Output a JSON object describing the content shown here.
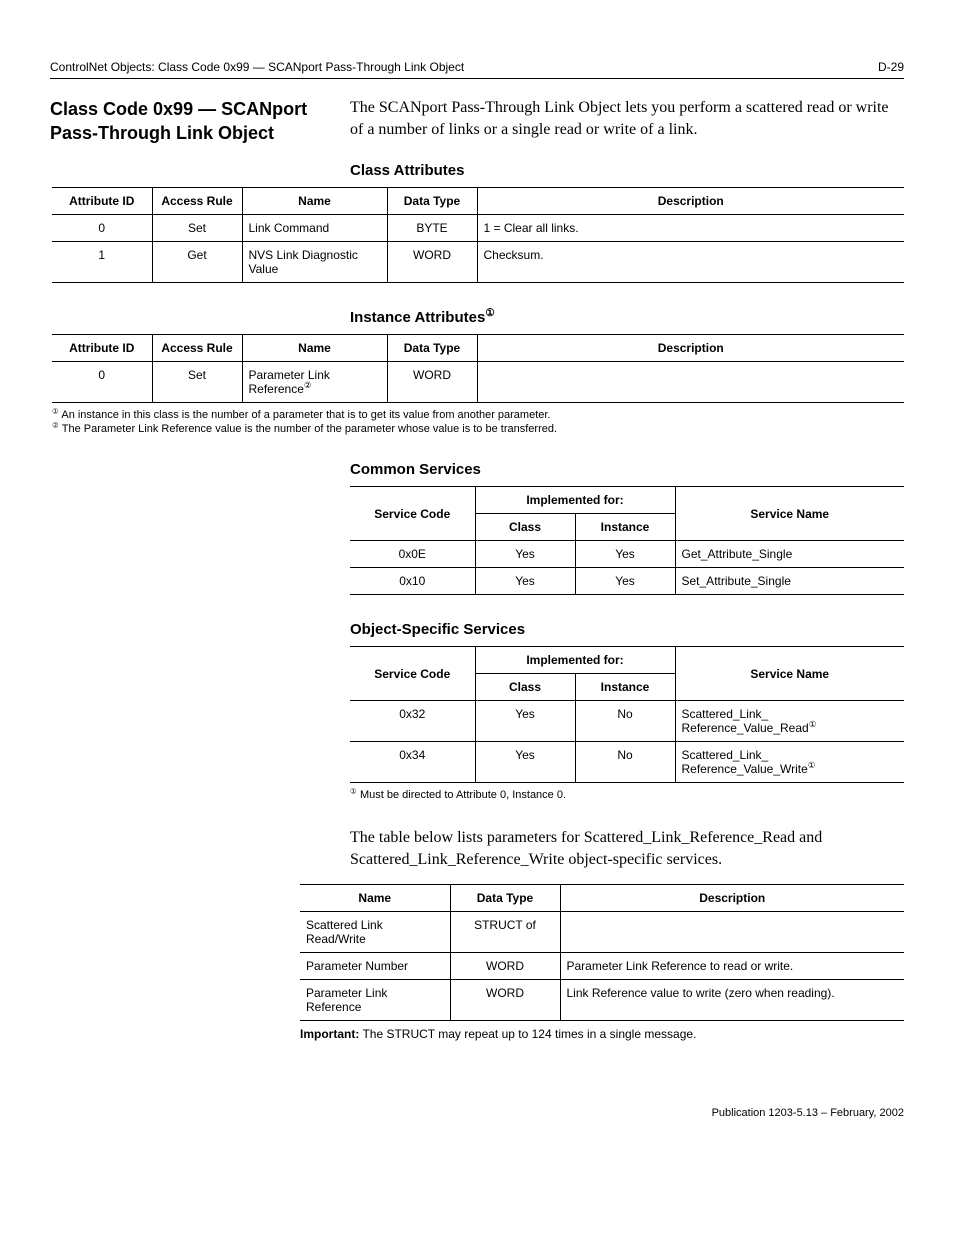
{
  "header": {
    "left": "ControlNet Objects: Class Code 0x99 — SCANport Pass-Through Link Object",
    "right": "D-29"
  },
  "title": "Class Code 0x99 — SCANport Pass-Through Link Object",
  "intro": "The SCANport Pass-Through Link Object lets you perform a scattered read or write of a number of links or a single read or write of a link.",
  "classAttr": {
    "heading": "Class Attributes",
    "headers": {
      "h1": "Attribute ID",
      "h2": "Access Rule",
      "h3": "Name",
      "h4": "Data Type",
      "h5": "Description"
    },
    "rows": [
      {
        "id": "0",
        "rule": "Set",
        "name": "Link Command",
        "dtype": "BYTE",
        "desc": "1 = Clear all links."
      },
      {
        "id": "1",
        "rule": "Get",
        "name": "NVS Link Diagnostic Value",
        "dtype": "WORD",
        "desc": "Checksum."
      }
    ]
  },
  "instAttr": {
    "heading": "Instance Attributes",
    "sup": "①",
    "headers": {
      "h1": "Attribute ID",
      "h2": "Access Rule",
      "h3": "Name",
      "h4": "Data Type",
      "h5": "Description"
    },
    "rows": [
      {
        "id": "0",
        "rule": "Set",
        "name": "Parameter Link Reference",
        "namesup": "②",
        "dtype": "WORD",
        "desc": ""
      }
    ],
    "foot1sup": "①",
    "foot1": " An instance in this class is the number of a parameter that is to get its value from another parameter.",
    "foot2sup": "②",
    "foot2": " The Parameter Link Reference value is the number of the parameter whose value is to be transferred."
  },
  "commonSvc": {
    "heading": "Common Services",
    "headers": {
      "h1": "Service Code",
      "h2": "Implemented for:",
      "h3": "Service Name",
      "s1": "Class",
      "s2": "Instance"
    },
    "rows": [
      {
        "code": "0x0E",
        "cls": "Yes",
        "inst": "Yes",
        "name": "Get_Attribute_Single"
      },
      {
        "code": "0x10",
        "cls": "Yes",
        "inst": "Yes",
        "name": "Set_Attribute_Single"
      }
    ]
  },
  "objSvc": {
    "heading": "Object-Specific Services",
    "headers": {
      "h1": "Service Code",
      "h2": "Implemented for:",
      "h3": "Service Name",
      "s1": "Class",
      "s2": "Instance"
    },
    "rows": [
      {
        "code": "0x32",
        "cls": "Yes",
        "inst": "No",
        "name": "Scattered_Link_ Reference_Value_Read",
        "sup": "①"
      },
      {
        "code": "0x34",
        "cls": "Yes",
        "inst": "No",
        "name": "Scattered_Link_ Reference_Value_Write",
        "sup": "①"
      }
    ],
    "footsup": "①",
    "foot": " Must be directed to Attribute 0, Instance 0."
  },
  "para": "The table below lists parameters for Scattered_Link_Reference_Read and Scattered_Link_Reference_Write object-specific services.",
  "paramTable": {
    "headers": {
      "h1": "Name",
      "h2": "Data Type",
      "h3": "Description"
    },
    "rows": [
      {
        "name": "Scattered Link Read/Write",
        "dtype": "STRUCT of",
        "desc": ""
      },
      {
        "name": "Parameter Number",
        "dtype": "WORD",
        "desc": "Parameter Link Reference to read or write."
      },
      {
        "name": "Parameter Link Reference",
        "dtype": "WORD",
        "desc": "Link Reference value to write (zero when reading)."
      }
    ],
    "impLabel": "Important:",
    "impText": " The STRUCT may repeat up to 124 times in a single message."
  },
  "pub": "Publication 1203-5.13 – February, 2002"
}
